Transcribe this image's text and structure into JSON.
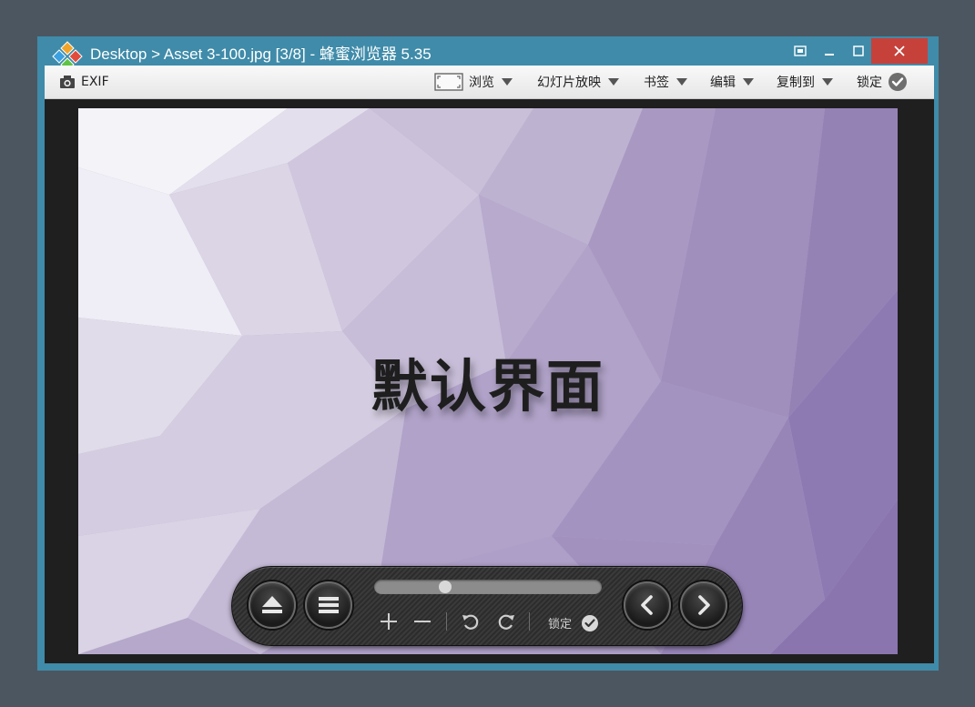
{
  "window": {
    "title": "Desktop > Asset 3-100.jpg [3/8] - 蜂蜜浏览器 5.35"
  },
  "toolbar": {
    "exif_label": "EXIF",
    "browse_label": "浏览",
    "slideshow_label": "幻灯片放映",
    "bookmarks_label": "书签",
    "edit_label": "编辑",
    "copy_to_label": "复制到",
    "lock_label": "锁定"
  },
  "image": {
    "caption": "默认界面"
  },
  "controls": {
    "lock_label": "锁定",
    "slider_position": 0.3
  },
  "colors": {
    "window_frame": "#3f8ba9",
    "close_button": "#c7413b",
    "desktop": "#4c5660"
  }
}
